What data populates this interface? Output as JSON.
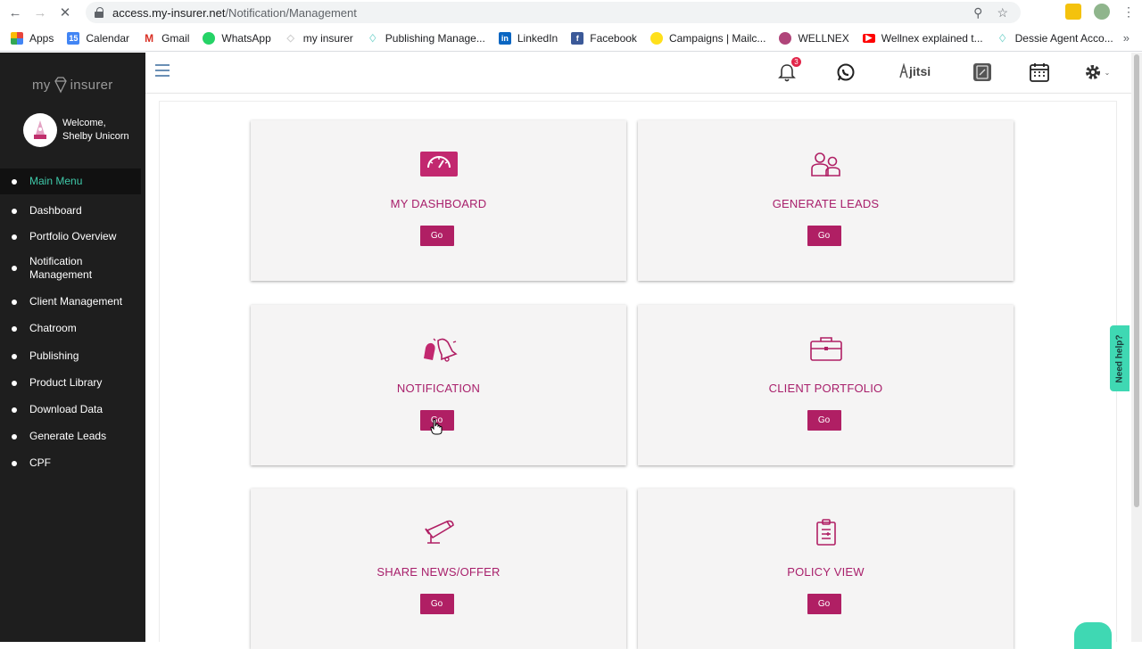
{
  "browser": {
    "url_host": "access.my-insurer.net",
    "url_path": "/Notification/Management",
    "bookmarks": [
      {
        "label": "Apps",
        "color": "#e8453c"
      },
      {
        "label": "Calendar",
        "color": "#4285f4",
        "badge": "15"
      },
      {
        "label": "Gmail",
        "color": "#d93025",
        "badge": "M"
      },
      {
        "label": "WhatsApp",
        "color": "#25d366"
      },
      {
        "label": "my insurer",
        "color": "#cfcfcf"
      },
      {
        "label": "Publishing Manage...",
        "color": "#7fd6cf"
      },
      {
        "label": "LinkedIn",
        "color": "#0a66c2",
        "badge": "in"
      },
      {
        "label": "Facebook",
        "color": "#3b5998",
        "badge": "f"
      },
      {
        "label": "Campaigns | Mailc...",
        "color": "#ffe01b"
      },
      {
        "label": "WELLNEX",
        "color": "#b0457a"
      },
      {
        "label": "Wellnex explained t...",
        "color": "#ff0000"
      },
      {
        "label": "Dessie Agent Acco...",
        "color": "#7fd6cf"
      }
    ]
  },
  "sidebar": {
    "logo_left": "my",
    "logo_right": "insurer",
    "welcome_line1": "Welcome,",
    "welcome_line2": "Shelby Unicorn",
    "items": [
      {
        "label": "Main Menu",
        "active": true
      },
      {
        "label": "Dashboard"
      },
      {
        "label": "Portfolio Overview"
      },
      {
        "label": "Notification Management"
      },
      {
        "label": "Client Management"
      },
      {
        "label": "Chatroom"
      },
      {
        "label": "Publishing"
      },
      {
        "label": "Product Library"
      },
      {
        "label": "Download Data"
      },
      {
        "label": "Generate Leads"
      },
      {
        "label": "CPF"
      }
    ]
  },
  "topbar": {
    "notification_count": "3",
    "jitsi_label": "jitsi"
  },
  "cards": [
    {
      "title": "MY DASHBOARD",
      "icon": "dashboard-gauge-icon",
      "button": "Go"
    },
    {
      "title": "GENERATE LEADS",
      "icon": "users-icon",
      "button": "Go"
    },
    {
      "title": "NOTIFICATION",
      "icon": "bells-icon",
      "button": "Go"
    },
    {
      "title": "CLIENT PORTFOLIO",
      "icon": "briefcase-icon",
      "button": "Go"
    },
    {
      "title": "SHARE NEWS/OFFER",
      "icon": "megaphone-icon",
      "button": "Go"
    },
    {
      "title": "POLICY VIEW",
      "icon": "clipboard-icon",
      "button": "Go"
    }
  ],
  "help": {
    "label": "Need help?"
  },
  "colors": {
    "accent": "#b01f64",
    "title": "#a81f6b",
    "sidebar_bg": "#1e1e1e",
    "active_menu": "#3fc9a9",
    "help": "#3fd8b3"
  }
}
